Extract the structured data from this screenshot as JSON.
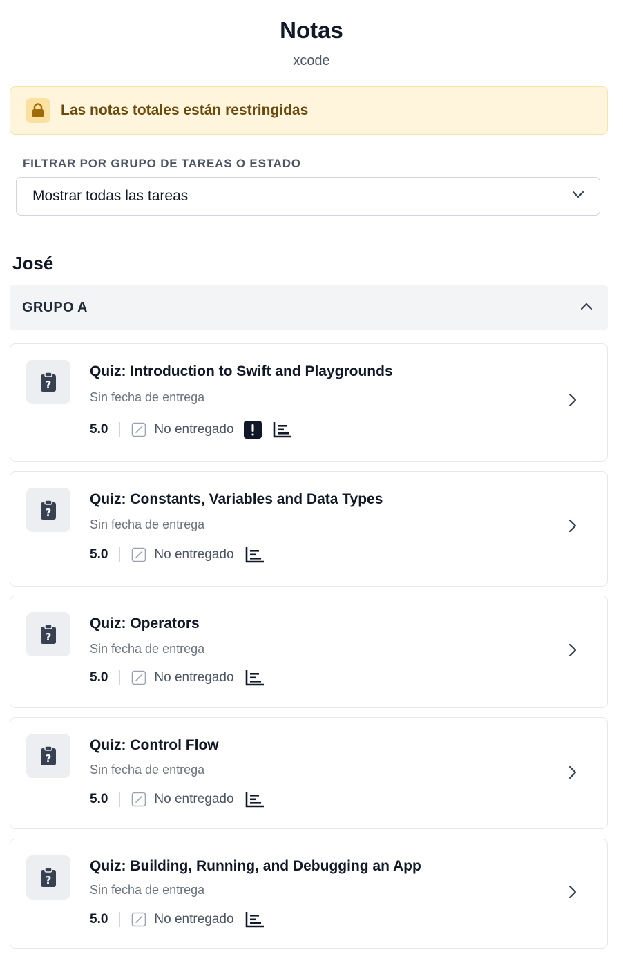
{
  "header": {
    "title": "Notas",
    "subtitle": "xcode"
  },
  "banner": {
    "icon": "lock-icon",
    "text": "Las notas totales están restringidas",
    "colors": {
      "background": "#fef5dc",
      "text": "#6b4a0d",
      "icon": "#a06a0a"
    }
  },
  "filter": {
    "label": "FILTRAR POR GRUPO DE TAREAS O ESTADO",
    "selected": "Mostrar todas las tareas"
  },
  "student": {
    "name": "José"
  },
  "group": {
    "title": "GRUPO A",
    "expanded": true
  },
  "assignments": [
    {
      "title": "Quiz: Introduction to Swift and Playgrounds",
      "due": "Sin fecha de entrega",
      "grade": "5.0",
      "status": "No entregado",
      "alert": true
    },
    {
      "title": "Quiz: Constants, Variables and Data Types",
      "due": "Sin fecha de entrega",
      "grade": "5.0",
      "status": "No entregado",
      "alert": false
    },
    {
      "title": "Quiz: Operators",
      "due": "Sin fecha de entrega",
      "grade": "5.0",
      "status": "No entregado",
      "alert": false
    },
    {
      "title": "Quiz: Control Flow",
      "due": "Sin fecha de entrega",
      "grade": "5.0",
      "status": "No entregado",
      "alert": false
    },
    {
      "title": "Quiz: Building, Running, and Debugging an App",
      "due": "Sin fecha de entrega",
      "grade": "5.0",
      "status": "No entregado",
      "alert": false
    }
  ]
}
